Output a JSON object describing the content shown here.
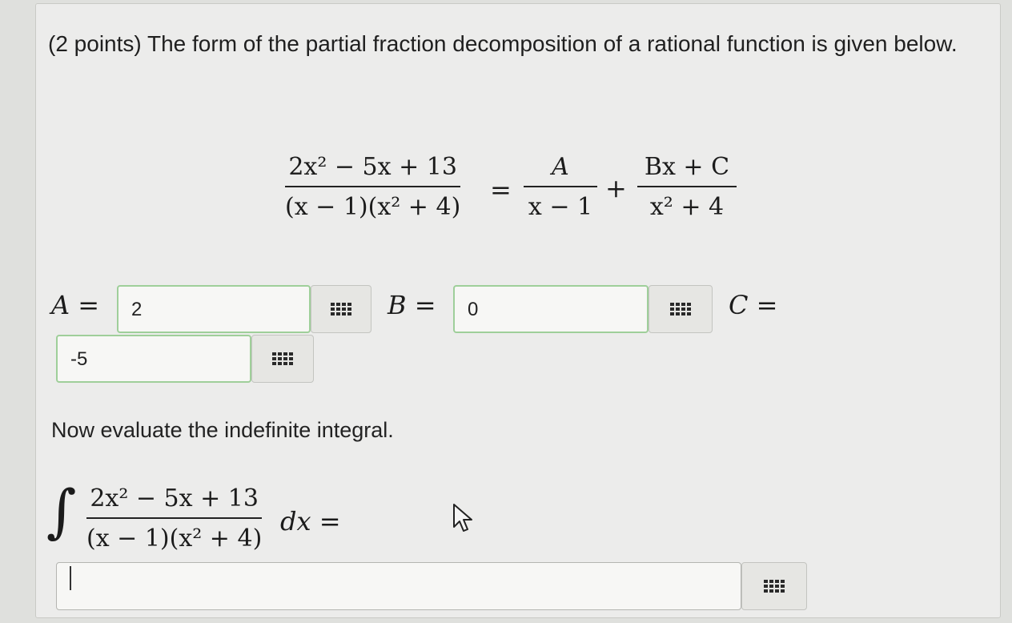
{
  "problem": {
    "intro": "(2 points) The form of the partial fraction decomposition of a rational function is given below.",
    "integral_prompt": "Now evaluate the indefinite integral."
  },
  "equation": {
    "lhs_num": "2x² − 5x + 13",
    "lhs_den": "(x − 1)(x² + 4)",
    "equals": "=",
    "term1_num": "A",
    "term1_den": "x − 1",
    "plus": "+",
    "term2_num": "Bx + C",
    "term2_den": "x² + 4"
  },
  "answers": {
    "a_label": "A =",
    "a_value": "2",
    "b_label": "B =",
    "b_value": "0",
    "c_label": "C =",
    "c_value": "-5"
  },
  "integral": {
    "num": "2x² − 5x + 13",
    "den": "(x − 1)(x² + 4)",
    "dx": "dx =",
    "answer_value": ""
  },
  "icons": {
    "keypad": "keypad-grid-icon",
    "pointer": "mouse-pointer-icon"
  }
}
